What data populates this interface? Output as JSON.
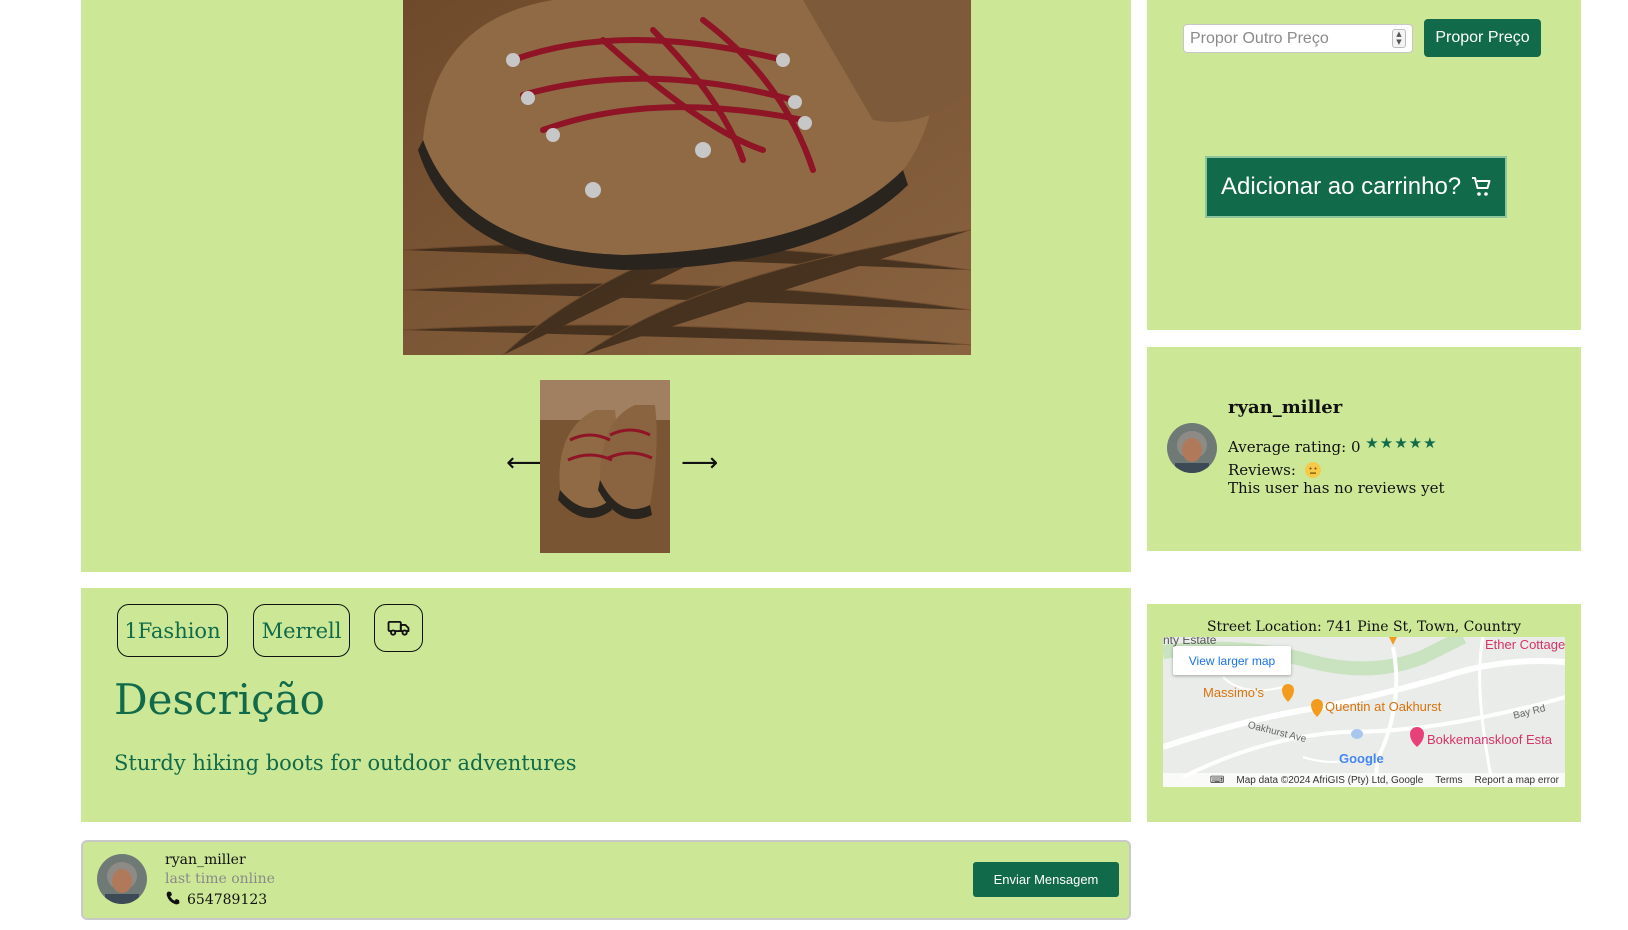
{
  "offer": {
    "price_placeholder": "Propor Outro Preço",
    "propose_label": "Propor Preço",
    "cart_label": "Adicionar ao carrinho?"
  },
  "seller": {
    "name": "ryan_miller",
    "rating_label": "Average rating: 0",
    "stars": "★★★★★",
    "reviews_label": "Reviews:",
    "no_reviews_text": "This user has no reviews yet"
  },
  "description": {
    "tags": [
      "1Fashion",
      "Merrell"
    ],
    "title": "Descrição",
    "text": "Sturdy hiking boots for outdoor adventures"
  },
  "gallery": {
    "prev_arrow": "⟵",
    "next_arrow": "⟶"
  },
  "map": {
    "address": "Street Location: 741 Pine St, Town, Country",
    "view_larger": "View larger map",
    "labels": {
      "estate": "nty Estate",
      "ether": "Ether Cottage",
      "massimos": "Massimo's",
      "quentin": "Quentin at Oakhurst",
      "bay_rd": "Bay Rd",
      "oakhurst_ave": "Oakhurst Ave",
      "bokkemanskloof": "Bokkemanskloof Esta",
      "google": "Google"
    },
    "footer": {
      "map_data": "Map data ©2024 AfriGIS (Pty) Ltd, Google",
      "terms": "Terms",
      "report": "Report a map error"
    }
  },
  "contact": {
    "name": "ryan_miller",
    "status": "last time online",
    "phone": "654789123",
    "send_label": "Enviar Mensagem"
  },
  "colors": {
    "panel": "#cce896",
    "primary": "#116b4a"
  }
}
